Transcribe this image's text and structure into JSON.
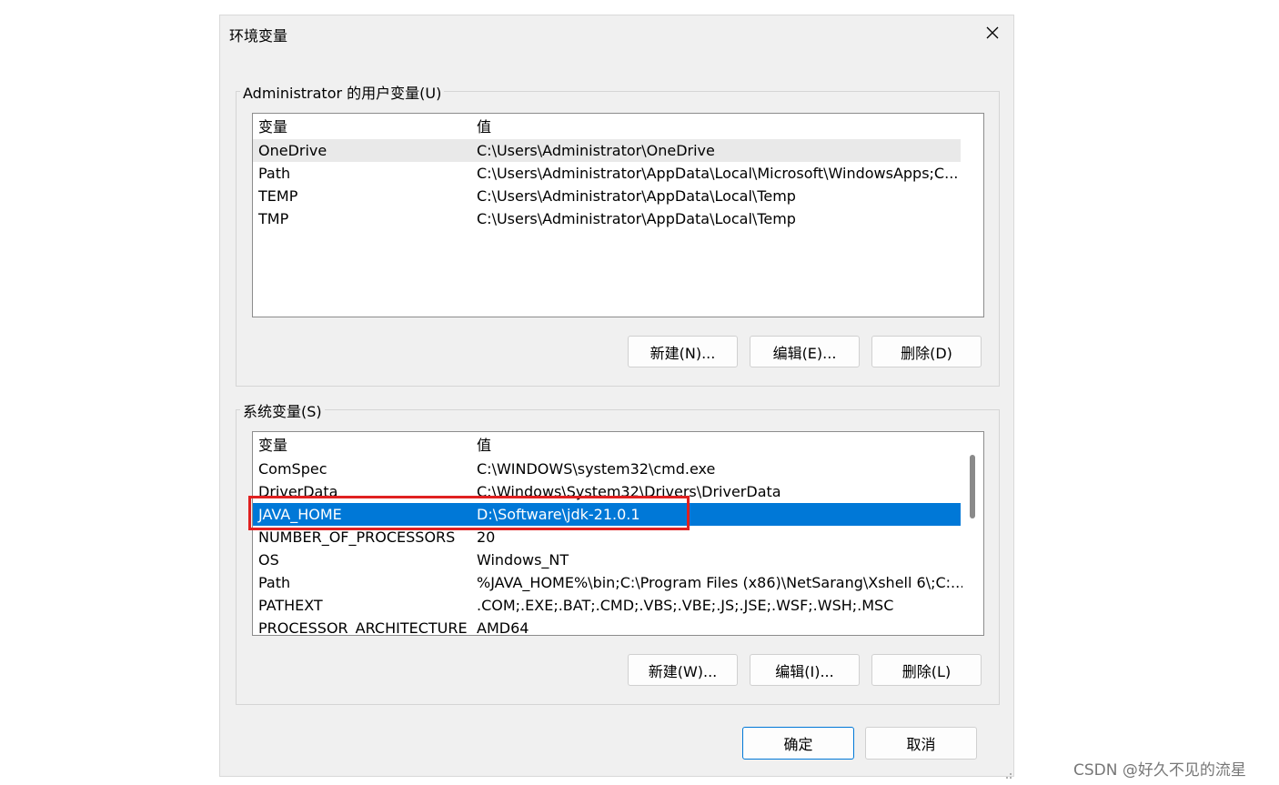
{
  "dialog": {
    "title": "环境变量",
    "close_symbol": "✕"
  },
  "user_vars": {
    "group_label": "Administrator 的用户变量(U)",
    "header": {
      "name": "变量",
      "value": "值"
    },
    "rows": [
      {
        "name": "OneDrive",
        "value": "C:\\Users\\Administrator\\OneDrive"
      },
      {
        "name": "Path",
        "value": "C:\\Users\\Administrator\\AppData\\Local\\Microsoft\\WindowsApps;C..."
      },
      {
        "name": "TEMP",
        "value": "C:\\Users\\Administrator\\AppData\\Local\\Temp"
      },
      {
        "name": "TMP",
        "value": "C:\\Users\\Administrator\\AppData\\Local\\Temp"
      }
    ],
    "buttons": {
      "new": "新建(N)...",
      "edit": "编辑(E)...",
      "delete": "删除(D)"
    }
  },
  "system_vars": {
    "group_label": "系统变量(S)",
    "header": {
      "name": "变量",
      "value": "值"
    },
    "rows": [
      {
        "name": "ComSpec",
        "value": "C:\\WINDOWS\\system32\\cmd.exe"
      },
      {
        "name": "DriverData",
        "value": "C:\\Windows\\System32\\Drivers\\DriverData"
      },
      {
        "name": "JAVA_HOME",
        "value": "D:\\Software\\jdk-21.0.1"
      },
      {
        "name": "NUMBER_OF_PROCESSORS",
        "value": "20"
      },
      {
        "name": "OS",
        "value": "Windows_NT"
      },
      {
        "name": "Path",
        "value": "%JAVA_HOME%\\bin;C:\\Program Files (x86)\\NetSarang\\Xshell 6\\;C:..."
      },
      {
        "name": "PATHEXT",
        "value": ".COM;.EXE;.BAT;.CMD;.VBS;.VBE;.JS;.JSE;.WSF;.WSH;.MSC"
      },
      {
        "name": "PROCESSOR_ARCHITECTURE",
        "value": "AMD64"
      }
    ],
    "buttons": {
      "new": "新建(W)...",
      "edit": "编辑(I)...",
      "delete": "删除(L)"
    }
  },
  "footer": {
    "ok": "确定",
    "cancel": "取消"
  },
  "watermark": "CSDN @好久不见的流星",
  "colors": {
    "selection": "#0078d7",
    "highlight_box": "#e02020"
  }
}
